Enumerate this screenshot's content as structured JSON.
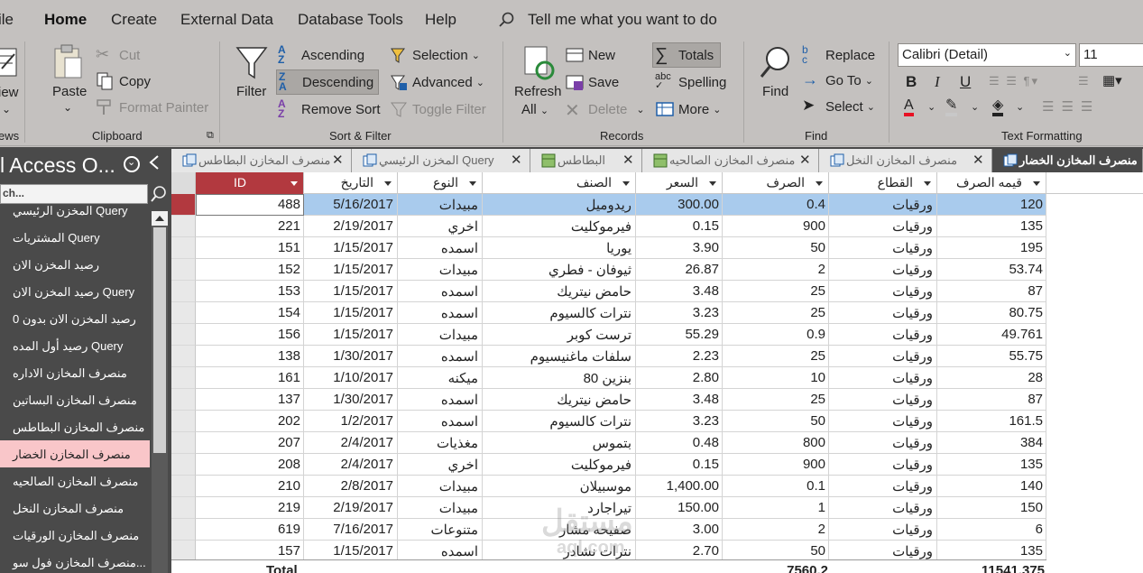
{
  "menu": {
    "items": [
      "ile",
      "Home",
      "Create",
      "External Data",
      "Database Tools",
      "Help"
    ],
    "tell_me": "Tell me what you want to do"
  },
  "ribbon": {
    "views": {
      "view_label": "iew",
      "group": "ews"
    },
    "clipboard": {
      "paste": "Paste",
      "cut": "Cut",
      "copy": "Copy",
      "format_painter": "Format Painter",
      "group": "Clipboard"
    },
    "sort_filter": {
      "filter": "Filter",
      "ascending": "Ascending",
      "descending": "Descending",
      "remove_sort": "Remove Sort",
      "selection": "Selection",
      "advanced": "Advanced",
      "toggle_filter": "Toggle Filter",
      "group": "Sort & Filter"
    },
    "records": {
      "refresh": "Refresh",
      "refresh_all": "All",
      "new": "New",
      "save": "Save",
      "delete": "Delete",
      "totals": "Totals",
      "spelling": "Spelling",
      "more": "More",
      "group": "Records"
    },
    "find": {
      "find": "Find",
      "replace": "Replace",
      "go_to": "Go To",
      "select": "Select",
      "group": "Find"
    },
    "text_formatting": {
      "font": "Calibri (Detail)",
      "size": "11",
      "bold": "B",
      "italic": "I",
      "underline": "U",
      "group": "Text Formatting"
    }
  },
  "nav": {
    "title": "l Access O...",
    "search_text": "ch...",
    "items": [
      "المخزن الرئيسي Query",
      "المشتريات Query",
      "رصيد المخزن الان",
      "رصيد المخزن الان Query",
      "رصيد المخزن الان بدون  0",
      "رصيد أول المده Query",
      "منصرف المخازن الاداره",
      "منصرف المخازن البساتين",
      "منصرف المخازن البطاطس",
      "منصرف المخازن الخضار",
      "منصرف المخازن الصالحيه",
      "منصرف المخازن النخل",
      "منصرف المخازن الورقيات",
      "منصرف المخازن فول سو..."
    ],
    "selected_index": 9
  },
  "tabs": [
    {
      "label": "منصرف المخازن البطاطس",
      "active": false
    },
    {
      "label": "المخزن الرئيسي Query",
      "active": false
    },
    {
      "label": "البطاطس",
      "active": false
    },
    {
      "label": "منصرف المخازن الصالحيه",
      "active": false
    },
    {
      "label": "منصرف المخازن النخل",
      "active": false
    },
    {
      "label": "منصرف المخازن الخضار",
      "active": true
    }
  ],
  "table": {
    "columns": [
      "ID",
      "التاريخ",
      "النوع",
      "الصنف",
      "السعر",
      "الصرف",
      "القطاع",
      "قيمه الصرف"
    ],
    "rows": [
      [
        "488",
        "5/16/2017",
        "مبيدات",
        "ريدوميل",
        "300.00",
        "0.4",
        "ورقيات",
        "120"
      ],
      [
        "221",
        "2/19/2017",
        "اخري",
        "فيرموكليت",
        "0.15",
        "900",
        "ورقيات",
        "135"
      ],
      [
        "151",
        "1/15/2017",
        "اسمده",
        "يوريا",
        "3.90",
        "50",
        "ورقيات",
        "195"
      ],
      [
        "152",
        "1/15/2017",
        "مبيدات",
        "ثيوفان - فطري",
        "26.87",
        "2",
        "ورقيات",
        "53.74"
      ],
      [
        "153",
        "1/15/2017",
        "اسمده",
        "حامض نيتريك",
        "3.48",
        "25",
        "ورقيات",
        "87"
      ],
      [
        "154",
        "1/15/2017",
        "اسمده",
        "نترات كالسيوم",
        "3.23",
        "25",
        "ورقيات",
        "80.75"
      ],
      [
        "156",
        "1/15/2017",
        "مبيدات",
        "ترست كوبر",
        "55.29",
        "0.9",
        "ورقيات",
        "49.761"
      ],
      [
        "138",
        "1/30/2017",
        "اسمده",
        "سلفات ماغنيسيوم",
        "2.23",
        "25",
        "ورقيات",
        "55.75"
      ],
      [
        "161",
        "1/10/2017",
        "ميكنه",
        "بنزين 80",
        "2.80",
        "10",
        "ورقيات",
        "28"
      ],
      [
        "137",
        "1/30/2017",
        "اسمده",
        "حامض نيتريك",
        "3.48",
        "25",
        "ورقيات",
        "87"
      ],
      [
        "202",
        "1/2/2017",
        "اسمده",
        "نترات كالسيوم",
        "3.23",
        "50",
        "ورقيات",
        "161.5"
      ],
      [
        "207",
        "2/4/2017",
        "مغذيات",
        "بتموس",
        "0.48",
        "800",
        "ورقيات",
        "384"
      ],
      [
        "208",
        "2/4/2017",
        "اخري",
        "فيرموكليت",
        "0.15",
        "900",
        "ورقيات",
        "135"
      ],
      [
        "210",
        "2/8/2017",
        "مبيدات",
        "موسبيلان",
        "1,400.00",
        "0.1",
        "ورقيات",
        "140"
      ],
      [
        "219",
        "2/19/2017",
        "مبيدات",
        "تيراجارد",
        "150.00",
        "1",
        "ورقيات",
        "150"
      ],
      [
        "619",
        "7/16/2017",
        "متنوعات",
        "صفيحه مشار",
        "3.00",
        "2",
        "ورقيات",
        "6"
      ],
      [
        "157",
        "1/15/2017",
        "اسمده",
        "نترات نشادر",
        "2.70",
        "50",
        "ورقيات",
        "135"
      ]
    ],
    "selected_row": 0,
    "total": {
      "label": "Total",
      "sarf": "7560.2",
      "value": "11541.375"
    }
  },
  "watermark": {
    "line1": "مستقل",
    "line2": "aql.com"
  },
  "colors": {
    "accent": "#b2393f",
    "selection": "#a9cbed",
    "nav_bg": "#4a4a4a",
    "ribbon_bg": "#c4c1bf"
  }
}
